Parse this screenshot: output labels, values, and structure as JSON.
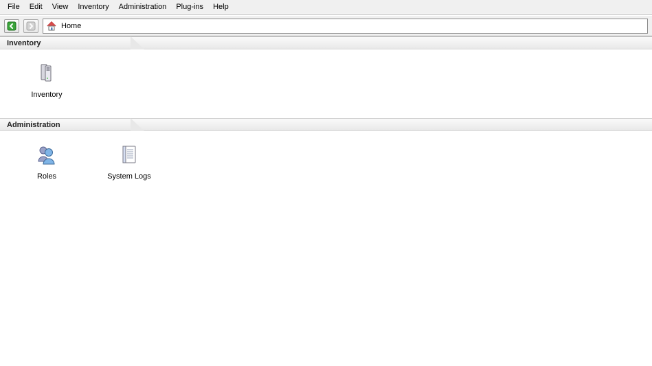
{
  "menu": {
    "items": [
      "File",
      "Edit",
      "View",
      "Inventory",
      "Administration",
      "Plug-ins",
      "Help"
    ]
  },
  "toolbar": {
    "back_enabled": true,
    "forward_enabled": false,
    "location_label": "Home"
  },
  "sections": {
    "inventory": {
      "title": "Inventory",
      "items": [
        {
          "label": "Inventory",
          "icon": "servers-icon"
        }
      ]
    },
    "administration": {
      "title": "Administration",
      "items": [
        {
          "label": "Roles",
          "icon": "users-icon"
        },
        {
          "label": "System Logs",
          "icon": "document-icon"
        }
      ]
    }
  }
}
